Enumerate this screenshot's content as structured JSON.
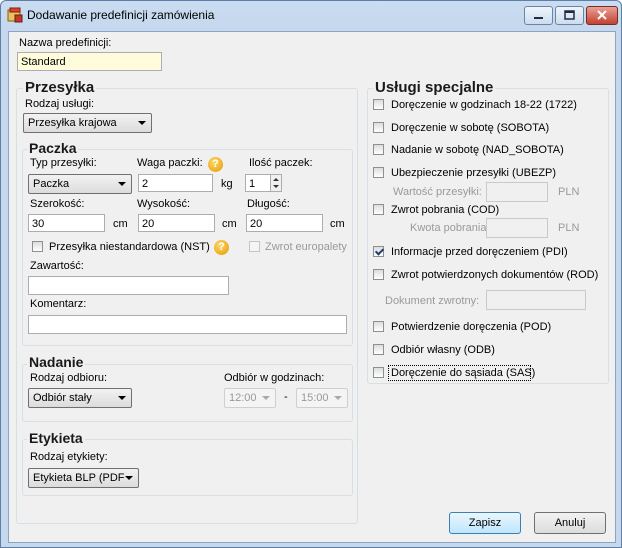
{
  "window": {
    "title": "Dodawanie predefinicji zamówienia"
  },
  "predef": {
    "label": "Nazwa predefinicji:",
    "value": "Standard"
  },
  "przesylka": {
    "title": "Przesyłka",
    "service_label": "Rodzaj usługi:",
    "service_value": "Przesyłka krajowa"
  },
  "paczka": {
    "title": "Paczka",
    "type_label": "Typ przesyłki:",
    "type_value": "Paczka",
    "weight_label": "Waga paczki:",
    "weight_value": "2",
    "weight_unit": "kg",
    "count_label": "Ilość paczek:",
    "count_value": "1",
    "width_label": "Szerokość:",
    "width_value": "30",
    "height_label": "Wysokość:",
    "height_value": "20",
    "length_label": "Długość:",
    "length_value": "20",
    "dim_unit": "cm",
    "nst_label": "Przesyłka niestandardowa (NST)",
    "euro_label": "Zwrot europalety",
    "content_label": "Zawartość:",
    "content_value": "",
    "comment_label": "Komentarz:",
    "comment_value": "",
    "help_glyph": "?"
  },
  "nadanie": {
    "title": "Nadanie",
    "pickup_label": "Rodzaj odbioru:",
    "pickup_value": "Odbiór stały",
    "hours_label": "Odbiór w godzinach:",
    "hour_from": "12:00",
    "hour_sep": "-",
    "hour_to": "15:00"
  },
  "etykieta": {
    "title": "Etykieta",
    "type_label": "Rodzaj etykiety:",
    "type_value": "Etykieta BLP (PDF"
  },
  "uslugi": {
    "title": "Usługi specjalne",
    "items": {
      "i1": {
        "label": "Doręczenie w godzinach 18-22 (1722)",
        "checked": false
      },
      "i2": {
        "label": "Doręczenie w sobotę (SOBOTA)",
        "checked": false
      },
      "i3": {
        "label": "Nadanie w sobotę (NAD_SOBOTA)",
        "checked": false
      },
      "i4": {
        "label": "Ubezpieczenie przesyłki (UBEZP)",
        "checked": false
      },
      "i5": {
        "label": "Zwrot pobrania (COD)",
        "checked": false
      },
      "i6": {
        "label": "Informacje przed doręczeniem (PDI)",
        "checked": true
      },
      "i7": {
        "label": "Zwrot potwierdzonych dokumentów (ROD)",
        "checked": false
      },
      "i8": {
        "label": "Potwierdzenie doręczenia (POD)",
        "checked": false
      },
      "i9": {
        "label": "Odbiór własny (ODB)",
        "checked": false
      },
      "i10": {
        "label": "Doręczenie do sąsiada (SAS)",
        "checked": false
      }
    },
    "insured_label": "Wartość przesyłki:",
    "insured_value": "",
    "cod_label": "Kwota pobrania:",
    "cod_value": "",
    "currency": "PLN",
    "doc_label": "Dokument zwrotny:",
    "doc_value": ""
  },
  "buttons": {
    "save": "Zapisz",
    "cancel": "Anuluj"
  }
}
